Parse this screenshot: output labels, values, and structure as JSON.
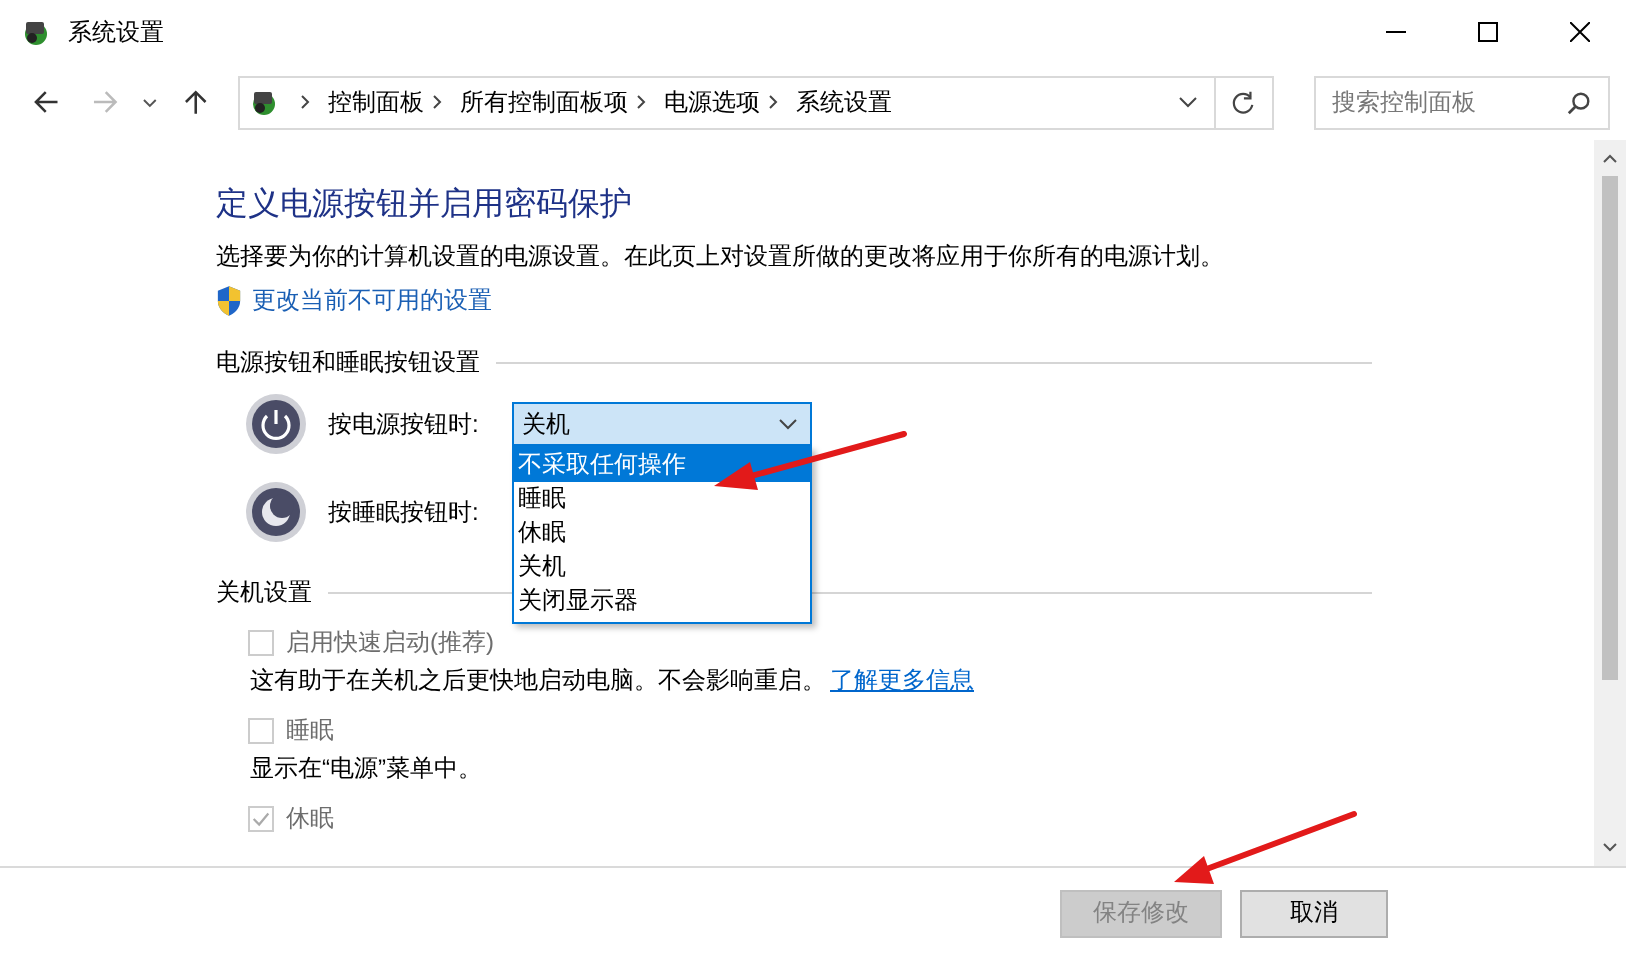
{
  "window": {
    "title": "系统设置"
  },
  "nav": {
    "breadcrumbs": [
      "控制面板",
      "所有控制面板项",
      "电源选项",
      "系统设置"
    ],
    "search": {
      "placeholder": "搜索控制面板"
    }
  },
  "heading": "定义电源按钮并启用密码保护",
  "description": "选择要为你的计算机设置的电源设置。在此页上对设置所做的更改将应用于你所有的电源计划。",
  "admin_link": "更改当前不可用的设置",
  "power_section": {
    "title": "电源按钮和睡眠按钮设置",
    "rows": [
      {
        "kind": "power",
        "label": "按电源按钮时:",
        "value": "关机",
        "expanded": true
      },
      {
        "kind": "sleep",
        "label": "按睡眠按钮时:"
      }
    ],
    "dropdown_options": [
      {
        "label": "不采取任何操作",
        "selected": true
      },
      {
        "label": "睡眠",
        "selected": false
      },
      {
        "label": "休眠",
        "selected": false
      },
      {
        "label": "关机",
        "selected": false
      },
      {
        "label": "关闭显示器",
        "selected": false
      }
    ]
  },
  "shutdown_section": {
    "title": "关机设置",
    "options": [
      {
        "label": "启用快速启动(推荐)",
        "checked": false,
        "disabled": true,
        "description": "这有助于在关机之后更快地启动电脑。不会影响重启。",
        "link": "了解更多信息"
      },
      {
        "label": "睡眠",
        "checked": false,
        "disabled": true,
        "description": "显示在“电源”菜单中。"
      },
      {
        "label": "休眠",
        "checked": true,
        "disabled": true
      }
    ]
  },
  "buttons": [
    {
      "label": "保存修改",
      "disabled": true
    },
    {
      "label": "取消",
      "disabled": false
    }
  ]
}
